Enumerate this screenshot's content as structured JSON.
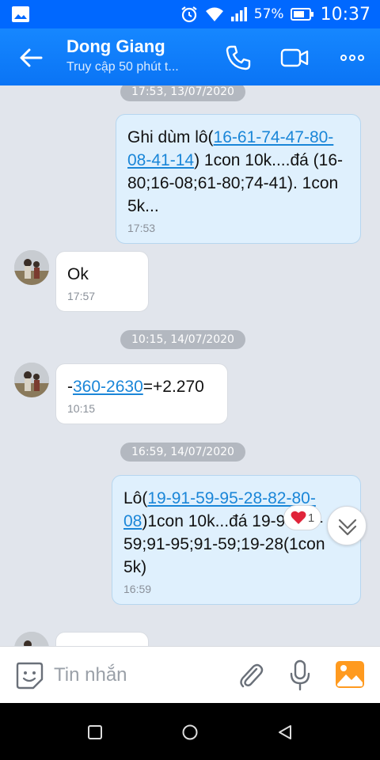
{
  "status_bar": {
    "battery_percent": "57%",
    "time": "10:37"
  },
  "header": {
    "title": "Dong Giang",
    "subtitle": "Truy cập 50 phút t..."
  },
  "dates": [
    "17:53, 13/07/2020",
    "10:15, 14/07/2020",
    "16:59, 14/07/2020"
  ],
  "messages": [
    {
      "direction": "out",
      "pre": "Ghi dùm lô(",
      "link": "16-61-74-47-80-08-41-14",
      "post": ") 1con 10k....đá (16-80;16-08;61-80;74-41). 1con 5k...",
      "time": "17:53"
    },
    {
      "direction": "in",
      "text": "Ok",
      "time": "17:57"
    },
    {
      "direction": "in",
      "pre": "-",
      "link": "360-2630",
      "post": "=+2.270",
      "time": "10:15"
    },
    {
      "direction": "out",
      "pre": "Lô(",
      "link": "19-91-59-95-28-82-80-08",
      "post": ")1con 10k...đá 19-95;19-59;91-95;91-59;19-28(1con 5k)",
      "time": "16:59"
    }
  ],
  "reaction": {
    "icon": "heart-icon",
    "count": "1"
  },
  "composer": {
    "placeholder": "Tin nhắn"
  },
  "colors": {
    "brand": "#0068ff",
    "bubble_out": "#dff0fd",
    "link": "#1a86d8",
    "background": "#e1e5ec"
  }
}
